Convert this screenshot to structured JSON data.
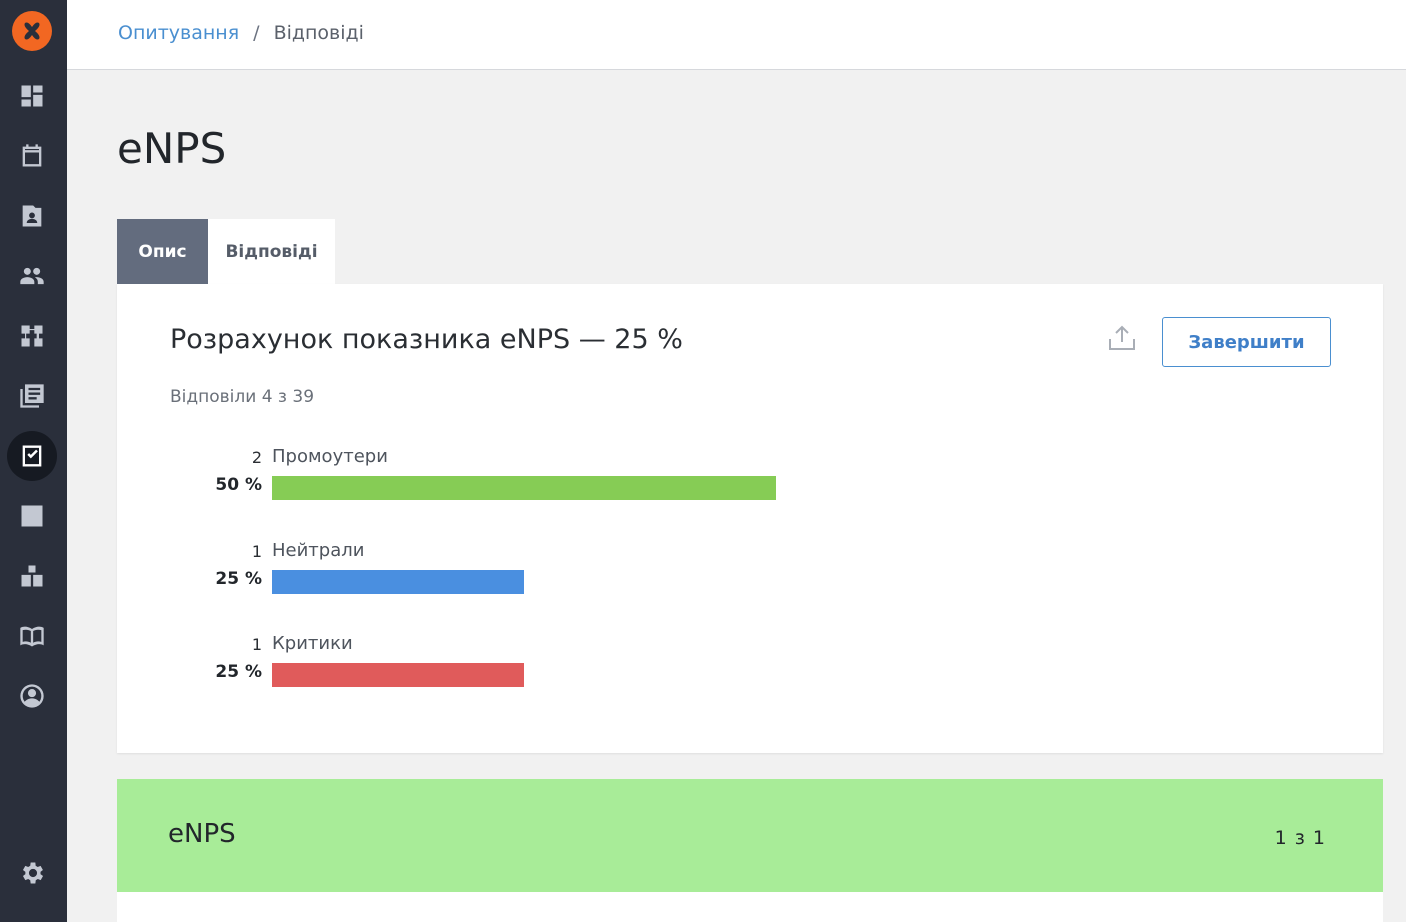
{
  "sidebar": {
    "logo": "x-logo",
    "items": [
      {
        "icon": "dashboard-icon",
        "active": false
      },
      {
        "icon": "calendar-icon",
        "active": false
      },
      {
        "icon": "contact-card-icon",
        "active": false
      },
      {
        "icon": "people-icon",
        "active": false
      },
      {
        "icon": "workflow-icon",
        "active": false
      },
      {
        "icon": "library-icon",
        "active": false
      },
      {
        "icon": "survey-check-icon",
        "active": true
      },
      {
        "icon": "analytics-chart-icon",
        "active": false
      },
      {
        "icon": "boxes-icon",
        "active": false
      },
      {
        "icon": "open-book-icon",
        "active": false
      },
      {
        "icon": "account-circle-icon",
        "active": false
      }
    ],
    "settings_icon": "gear-icon"
  },
  "breadcrumb": {
    "parent": "Опитування",
    "separator": "/",
    "current": "Відповіді"
  },
  "page": {
    "title": "eNPS"
  },
  "tabs": [
    {
      "label": "Опис",
      "active": true
    },
    {
      "label": "Відповіді",
      "active": false
    }
  ],
  "results": {
    "title": "Розрахунок показника eNPS — 25 %",
    "answered": "Відповіли 4 з 39",
    "finish_label": "Завершити",
    "export_icon": "upload-icon",
    "stats": [
      {
        "count": "2",
        "label": "Промоутери",
        "percent_label": "50 %",
        "percent": 50,
        "color": "#86cc55"
      },
      {
        "count": "1",
        "label": "Нейтрали",
        "percent_label": "25 %",
        "percent": 25,
        "color": "#4a8fe0"
      },
      {
        "count": "1",
        "label": "Критики",
        "percent_label": "25 %",
        "percent": 25,
        "color": "#e05b5b"
      }
    ]
  },
  "question": {
    "title": "eNPS",
    "counter": "1 з 1",
    "background": "#a8ec98"
  }
}
